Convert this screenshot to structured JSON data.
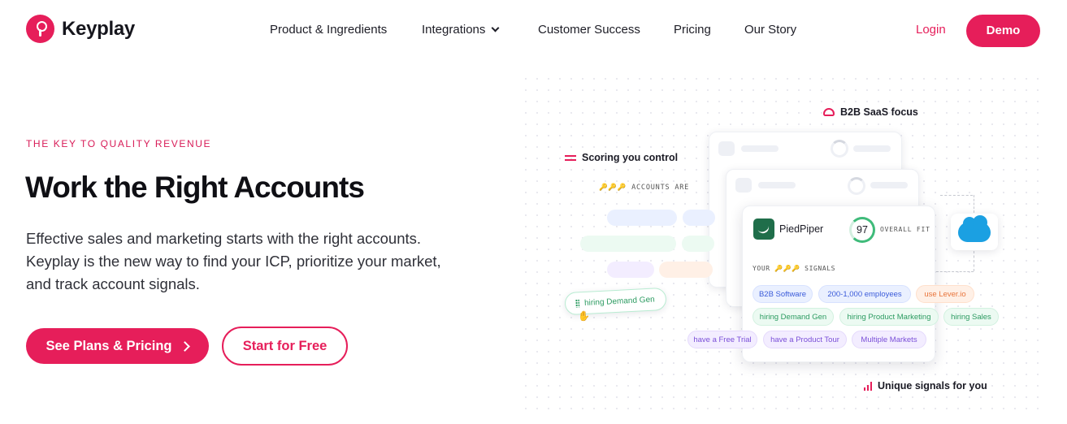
{
  "brand": {
    "name": "Keyplay",
    "accent": "#e61e5a"
  },
  "nav": {
    "items": [
      {
        "label": "Product & Ingredients"
      },
      {
        "label": "Integrations",
        "has_dropdown": true
      },
      {
        "label": "Customer Success"
      },
      {
        "label": "Pricing"
      },
      {
        "label": "Our Story"
      }
    ],
    "login": "Login",
    "demo": "Demo"
  },
  "hero": {
    "eyebrow": "THE KEY TO QUALITY REVENUE",
    "title": "Work the Right Accounts",
    "lead": "Effective sales and marketing starts with the right accounts. Keyplay is the new way to find your ICP, prioritize your market, and track account signals.",
    "primary_cta": "See Plans & Pricing",
    "secondary_cta": "Start for Free"
  },
  "illustration": {
    "b2b_label": "B2B SaaS focus",
    "scoring_label": "Scoring you control",
    "accounts_are": "🔑🔑🔑 ACCOUNTS ARE",
    "hiring_chip": "hiring Demand Gen",
    "company": "PiedPiper",
    "score": "97",
    "overall_fit": "OVERALL FIT",
    "signals_label": "YOUR 🔑🔑🔑 SIGNALS",
    "chips": [
      {
        "label": "B2B Software",
        "color": "blue"
      },
      {
        "label": "200-1,000 employees",
        "color": "blue"
      },
      {
        "label": "use Lever.io",
        "color": "orange"
      },
      {
        "label": "hiring Demand Gen",
        "color": "green"
      },
      {
        "label": "hiring Product Marketing",
        "color": "green"
      },
      {
        "label": "hiring Sales",
        "color": "green"
      },
      {
        "label": "have a Free Trial",
        "color": "purple"
      },
      {
        "label": "have a Product Tour",
        "color": "purple"
      },
      {
        "label": "Multiple Markets",
        "color": "purple"
      }
    ],
    "unique_label": "Unique signals for you"
  }
}
